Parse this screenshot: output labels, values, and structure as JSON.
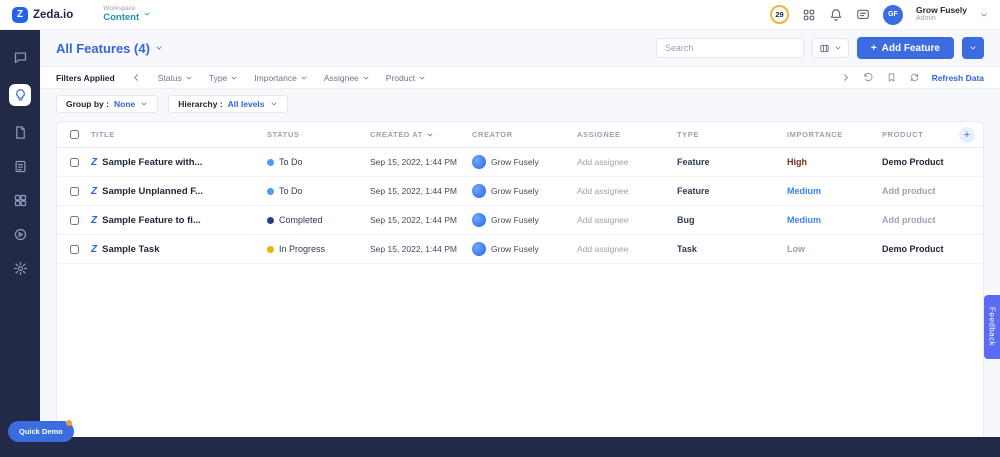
{
  "topbar": {
    "logo": "Zeda.io",
    "logo_letter": "Z",
    "workspace_label": "Workspace",
    "workspace_name": "Content",
    "credits": "29",
    "user_initials": "GF",
    "user_name": "Grow Fusely",
    "user_role": "Admin"
  },
  "sidebar": {
    "items": [
      "inbox",
      "features",
      "docs",
      "lists",
      "apps",
      "academy",
      "settings"
    ]
  },
  "page": {
    "title": "All Features (4)",
    "search_placeholder": "Search",
    "add_feature": "Add Feature",
    "add_plus": "+"
  },
  "filter_bar": {
    "label": "Filters Applied",
    "filters": [
      "Status",
      "Type",
      "Importance",
      "Assignee",
      "Product"
    ],
    "refresh": "Refresh Data"
  },
  "group_bar": {
    "group_by_label": "Group by :",
    "group_by_value": "None",
    "hierarchy_label": "Hierarchy :",
    "hierarchy_value": "All levels"
  },
  "table": {
    "feature_icon_letter": "Z",
    "add_column": "+",
    "headers": {
      "title": "TITLE",
      "status": "STATUS",
      "created": "CREATED AT",
      "creator": "CREATOR",
      "assignee": "ASSIGNEE",
      "type": "TYPE",
      "importance": "IMPORTANCE",
      "product": "PRODUCT"
    },
    "rows": [
      {
        "title": "Sample Feature with...",
        "status": "To Do",
        "status_color": "#4c9aff",
        "created": "Sep 15, 2022, 1:44 PM",
        "creator": "Grow Fusely",
        "assignee": "Add assignee",
        "type": "Feature",
        "importance": "High",
        "importance_color": "#7a2e1d",
        "product": "Demo Product",
        "product_color": "#1d2433"
      },
      {
        "title": "Sample Unplanned F...",
        "status": "To Do",
        "status_color": "#4c9aff",
        "created": "Sep 15, 2022, 1:44 PM",
        "creator": "Grow Fusely",
        "assignee": "Add assignee",
        "type": "Feature",
        "importance": "Medium",
        "importance_color": "#3b82f6",
        "product": "Add product",
        "product_color": "#9aa3b2"
      },
      {
        "title": "Sample Feature to fi...",
        "status": "Completed",
        "status_color": "#2e3a8c",
        "created": "Sep 15, 2022, 1:44 PM",
        "creator": "Grow Fusely",
        "assignee": "Add assignee",
        "type": "Bug",
        "importance": "Medium",
        "importance_color": "#3b82f6",
        "product": "Add product",
        "product_color": "#9aa3b2"
      },
      {
        "title": "Sample Task",
        "status": "In Progress",
        "status_color": "#f2b200",
        "created": "Sep 15, 2022, 1:44 PM",
        "creator": "Grow Fusely",
        "assignee": "Add assignee",
        "type": "Task",
        "importance": "Low",
        "importance_color": "#98a1b3",
        "product": "Demo Product",
        "product_color": "#1d2433"
      }
    ]
  },
  "feedback": "Feedback",
  "quick_demo": "Quick Demo",
  "colors": {
    "accent": "#3b6ce0",
    "sidebar_bg": "#232a47",
    "feedback_bg": "#5a6cf3",
    "credits_ring": "#f2b13d"
  }
}
